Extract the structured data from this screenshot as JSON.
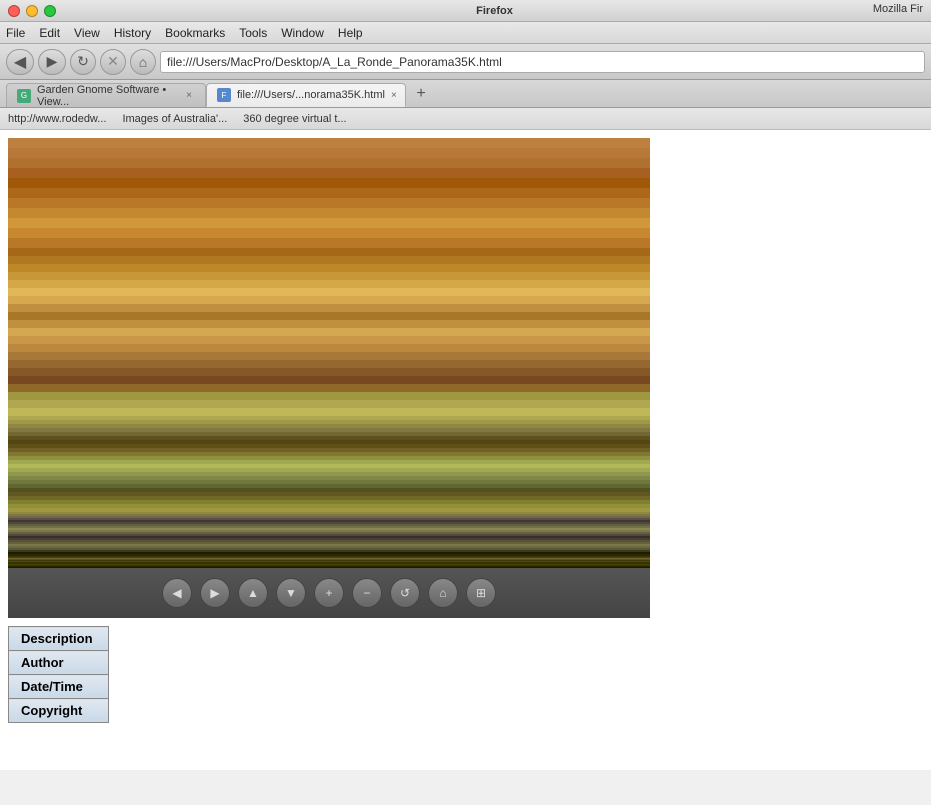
{
  "titlebar": {
    "app_name": "Firefox",
    "mozilla_label": "Mozilla Fir"
  },
  "menubar": {
    "items": [
      "File",
      "Edit",
      "View",
      "History",
      "Bookmarks",
      "Tools",
      "Window",
      "Help"
    ]
  },
  "navbar": {
    "url": "file:///Users/MacPro/Desktop/A_La_Ronde_Panorama35K.html"
  },
  "tabs": [
    {
      "label": "Garden Gnome Software • View...",
      "active": false,
      "favicon": "G"
    },
    {
      "label": "file:///Users/...norama35K.html",
      "active": true,
      "favicon": "F"
    }
  ],
  "bookmarks": [
    {
      "label": "http://www.rodedw..."
    },
    {
      "label": "Images of Australia'..."
    },
    {
      "label": "360 degree virtual t..."
    }
  ],
  "panorama": {
    "controls": [
      {
        "symbol": "◀",
        "name": "pan-left"
      },
      {
        "symbol": "▶",
        "name": "pan-right"
      },
      {
        "symbol": "▲",
        "name": "tilt-up"
      },
      {
        "symbol": "▼",
        "name": "tilt-down"
      },
      {
        "symbol": "+",
        "name": "zoom-in"
      },
      {
        "symbol": "−",
        "name": "zoom-out"
      },
      {
        "symbol": "↺",
        "name": "rotate"
      },
      {
        "symbol": "⌂",
        "name": "home"
      },
      {
        "symbol": "⊞",
        "name": "fullscreen"
      }
    ]
  },
  "info": {
    "rows": [
      {
        "label": "Description"
      },
      {
        "label": "Author"
      },
      {
        "label": "Date/Time"
      },
      {
        "label": "Copyright"
      }
    ]
  },
  "new_tab_symbol": "+"
}
